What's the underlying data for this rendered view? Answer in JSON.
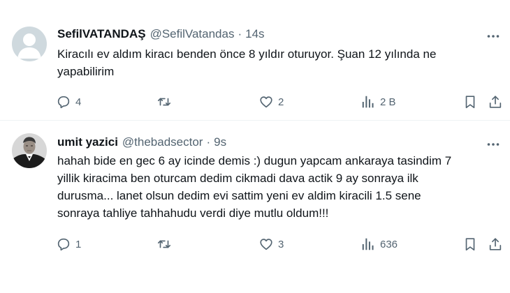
{
  "tweets": [
    {
      "display_name": "SefilVATANDAŞ",
      "handle": "@SefilVatandas",
      "separator": "·",
      "time": "14s",
      "text_lines": [
        "Kiracılı ev aldım kiracı benden önce 8 yıldır oturuyor. Şuan 12 yılında ne",
        "yapabilirim"
      ],
      "avatar_icon": "default-avatar-icon",
      "actions": {
        "replies": "4",
        "retweets": "",
        "likes": "2",
        "views": "2 B"
      }
    },
    {
      "display_name": "umit yazici",
      "handle": "@thebadsector",
      "separator": "·",
      "time": "9s",
      "text_lines": [
        "hahah bide en gec 6 ay icinde demis :) dugun yapcam ankaraya tasindim 7",
        "yillik kiracima ben oturcam dedim cikmadi dava actik 9 ay sonraya ilk",
        "durusma... lanet olsun dedim evi sattim yeni ev aldim kiracili 1.5 sene",
        "sonraya tahliye tahhahudu verdi diye mutlu oldum!!!"
      ],
      "avatar_icon": "profile-photo",
      "actions": {
        "replies": "1",
        "retweets": "",
        "likes": "3",
        "views": "636"
      }
    }
  ],
  "icons": [
    "more-icon",
    "reply-icon",
    "retweet-icon",
    "like-icon",
    "views-icon",
    "bookmark-icon",
    "share-icon"
  ],
  "colors": {
    "text": "#0f1419",
    "secondary": "#536471",
    "divider": "#eff3f4",
    "avatar_bg": "#cfd9de"
  }
}
